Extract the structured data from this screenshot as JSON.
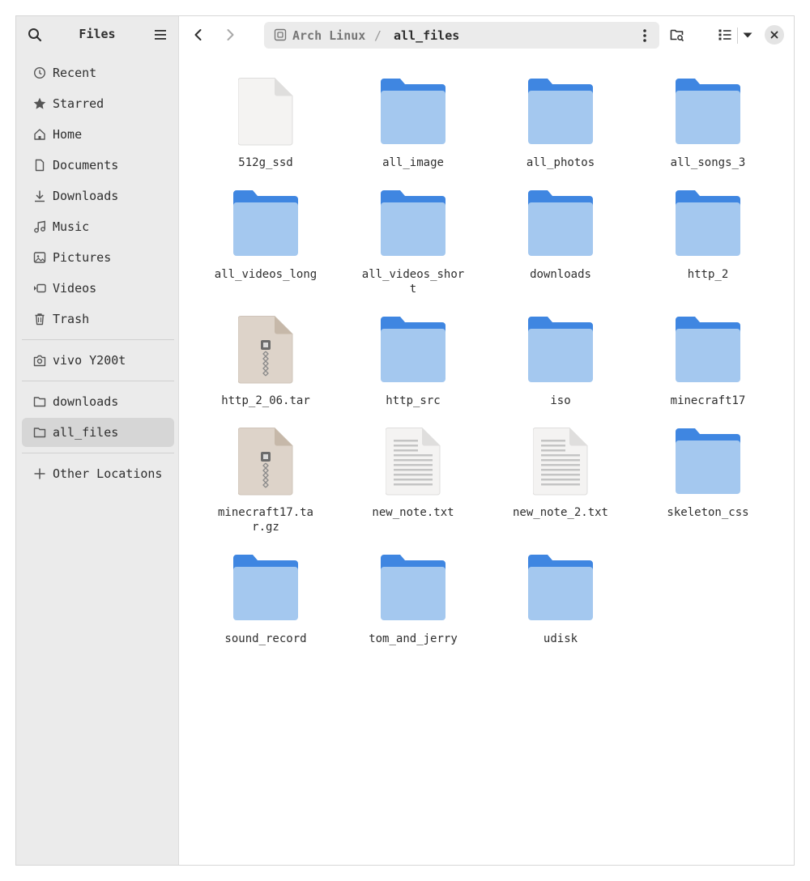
{
  "sidebar": {
    "title": "Files",
    "places": [
      {
        "label": "Recent",
        "icon": "clock-icon"
      },
      {
        "label": "Starred",
        "icon": "star-icon"
      },
      {
        "label": "Home",
        "icon": "home-icon"
      },
      {
        "label": "Documents",
        "icon": "document-icon"
      },
      {
        "label": "Downloads",
        "icon": "download-icon"
      },
      {
        "label": "Music",
        "icon": "music-icon"
      },
      {
        "label": "Pictures",
        "icon": "picture-icon"
      },
      {
        "label": "Videos",
        "icon": "video-icon"
      },
      {
        "label": "Trash",
        "icon": "trash-icon"
      }
    ],
    "devices": [
      {
        "label": "vivo Y200t",
        "icon": "camera-icon"
      }
    ],
    "bookmarks": [
      {
        "label": "downloads",
        "icon": "folder-icon"
      },
      {
        "label": "all_files",
        "icon": "folder-icon",
        "active": true
      }
    ],
    "other": {
      "label": "Other Locations",
      "icon": "plus-icon"
    }
  },
  "header": {
    "path_root": "Arch Linux",
    "path_separator": "/",
    "path_current": "all_files"
  },
  "files": [
    {
      "name": "512g_ssd",
      "type": "blank"
    },
    {
      "name": "all_image",
      "type": "folder"
    },
    {
      "name": "all_photos",
      "type": "folder"
    },
    {
      "name": "all_songs_3",
      "type": "folder"
    },
    {
      "name": "all_videos_long",
      "type": "folder"
    },
    {
      "name": "all_videos_short",
      "type": "folder"
    },
    {
      "name": "downloads",
      "type": "folder"
    },
    {
      "name": "http_2",
      "type": "folder"
    },
    {
      "name": "http_2_06.tar",
      "type": "archive"
    },
    {
      "name": "http_src",
      "type": "folder"
    },
    {
      "name": "iso",
      "type": "folder"
    },
    {
      "name": "minecraft17",
      "type": "folder"
    },
    {
      "name": "minecraft17.tar.gz",
      "type": "archive"
    },
    {
      "name": "new_note.txt",
      "type": "text"
    },
    {
      "name": "new_note_2.txt",
      "type": "text"
    },
    {
      "name": "skeleton_css",
      "type": "folder"
    },
    {
      "name": "sound_record",
      "type": "folder"
    },
    {
      "name": "tom_and_jerry",
      "type": "folder"
    },
    {
      "name": "udisk",
      "type": "folder"
    }
  ],
  "colors": {
    "folder_back": "#3f86e1",
    "folder_front": "#a4c8ef",
    "sidebar_bg": "#ebebeb",
    "active_item_bg": "#d6d6d6",
    "archive_bg": "#ddd3c9"
  }
}
